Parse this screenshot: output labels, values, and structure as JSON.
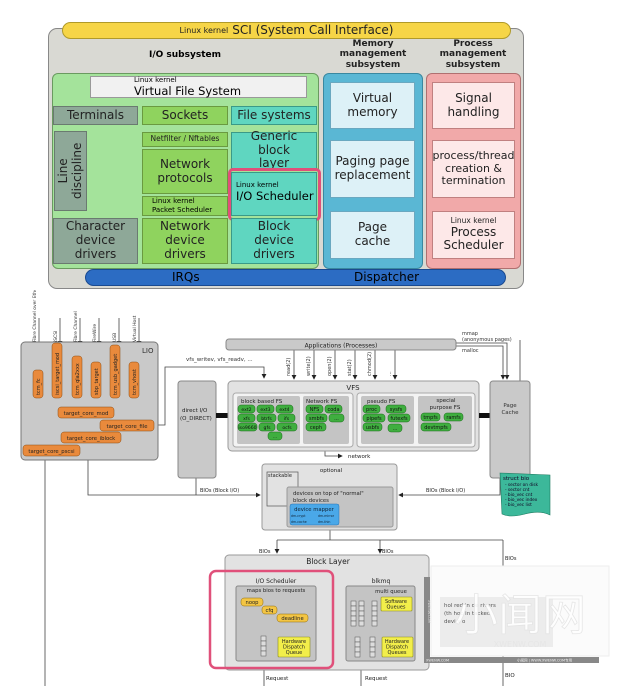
{
  "kernel_map": {
    "sci": {
      "prefix": "Linux kernel",
      "label": "SCI (System Call Interface)"
    },
    "io_subsystem": {
      "title": "I/O subsystem",
      "vfs": {
        "prefix": "Linux kernel",
        "label": "Virtual File System"
      },
      "terminals": "Terminals",
      "sockets": "Sockets",
      "file_systems": "File systems",
      "line_discipline": "Line discipline",
      "netfilter": "Netfilter / Nftables",
      "network_protocols": "Network protocols",
      "packet_scheduler": {
        "prefix": "Linux kernel",
        "label": "Packet Scheduler"
      },
      "generic_block_layer": "Generic block layer",
      "io_scheduler": {
        "prefix": "Linux kernel",
        "label": "I/O Scheduler"
      },
      "character_device_drivers": "Character device drivers",
      "network_device_drivers": "Network device drivers",
      "block_device_drivers": "Block device drivers"
    },
    "memory": {
      "title": "Memory management subsystem",
      "virtual_memory": "Virtual memory",
      "paging": "Paging page replacement",
      "page_cache": "Page cache"
    },
    "process": {
      "title": "Process management subsystem",
      "signal_handling": "Signal handling",
      "process_thread": "process/thread creation & termination",
      "scheduler": {
        "prefix": "Linux kernel",
        "label": "Process Scheduler"
      }
    },
    "irqs": "IRQs",
    "dispatcher": "Dispatcher"
  },
  "io_stack": {
    "inputs": [
      "Fibre Channel over Ethernet",
      "iSCSI",
      "Fibre Channel",
      "FireWire",
      "USB",
      "Virtual Host"
    ],
    "lio": {
      "title": "LIO",
      "fabric_modules": [
        "tcm_fc",
        "iscsi_target_mod",
        "tcm_qla2xxx",
        "sbp_target",
        "tcm_usb_gadget",
        "tcm_vhost"
      ],
      "target_core_mod": "target_core_mod",
      "target_core_file": "target_core_file",
      "target_core_iblock": "target_core_iblock",
      "target_core_pscsi": "target_core_pscsi"
    },
    "vfs_calls": "vfs_writev, vfs_readv, ...",
    "applications": "Applications (Processes)",
    "mmap": "mmap",
    "anonymous_pages": "(anonymous pages)",
    "malloc": "malloc",
    "syscalls": [
      "read(2)",
      "write(2)",
      "open(2)",
      "stat(2)",
      "chmod(2)",
      "..."
    ],
    "direct_io": [
      "direct I/O",
      "(O_DIRECT)"
    ],
    "page_cache": [
      "Page",
      "Cache"
    ],
    "vfs": {
      "title": "VFS",
      "block_fs": {
        "title": "block based FS",
        "items": [
          "ext2",
          "ext3",
          "ext4",
          "xfs",
          "btrfs",
          "ifs",
          "iso9660",
          "gfs",
          "ocfs",
          "..."
        ]
      },
      "network_fs": {
        "title": "Network FS",
        "items": [
          "NFS",
          "coda",
          "smbfs",
          "...",
          "ceph"
        ]
      },
      "pseudo_fs": {
        "title": "pseudo FS",
        "items": [
          "proc",
          "sysfs",
          "pipefs",
          "futexfs",
          "usbfs",
          "..."
        ]
      },
      "special_fs": {
        "title": [
          "special",
          "purpose FS"
        ],
        "items": [
          "tmpfs",
          "ramfs",
          "devtmpfs"
        ]
      }
    },
    "network": "network",
    "bios_block_io": "BIOs (Block I/O)",
    "optional": {
      "title": "optional",
      "stackable": "stackable",
      "devices_title": [
        "devices on top of \"normal\"",
        "block devices"
      ],
      "device_mapper": "device mapper",
      "dm_targets": [
        "dm-crypt",
        "dm-mirror",
        "dm-cache",
        "dm-thin"
      ],
      "items": [
        "drbd",
        "LVM",
        "mdraid",
        "bcache",
        "..."
      ]
    },
    "struct_bio": {
      "title": "struct bio",
      "fields": [
        "- sector on disk",
        "- sector cnt",
        "- bio_vec cnt",
        "- bio_vec index",
        "- bio_vec list"
      ]
    },
    "bios": "BIOs",
    "block_layer": {
      "title": "Block Layer",
      "io_scheduler": {
        "title": "I/O Scheduler",
        "subtitle": "maps bios to requests",
        "schedulers": [
          "noop",
          "cfq",
          "deadline"
        ],
        "hw_queue": [
          "Hardware",
          "Dispatch",
          "Queue"
        ]
      },
      "blkmq": {
        "title": "blkmq",
        "subtitle": "multi queue",
        "sw_queues": [
          "Software",
          "Queues"
        ],
        "hw_queues": [
          "Hardware",
          "Dispatch",
          "Queues"
        ]
      }
    },
    "request": "Request",
    "bio": "BIO",
    "obscured_text": [
      "hol red in de  rivers",
      "(th   hoc  in  tacked",
      "devi s o"
    ],
    "watermark": {
      "logo": "小闻网",
      "url": "XWENW.COM",
      "side": "XWENW.COM",
      "footer": "小闻网 | WWW.XWENW.COM专用"
    },
    "colors": {
      "highlight": "#e0507a",
      "lio_module": "#e98a3c",
      "fs_chip": "#3fae3f",
      "dm_chip": "#4aa8e8",
      "sched_chip": "#f3c544",
      "queue_box": "#f2ee4a",
      "struct_bio": "#3cb89a"
    }
  }
}
